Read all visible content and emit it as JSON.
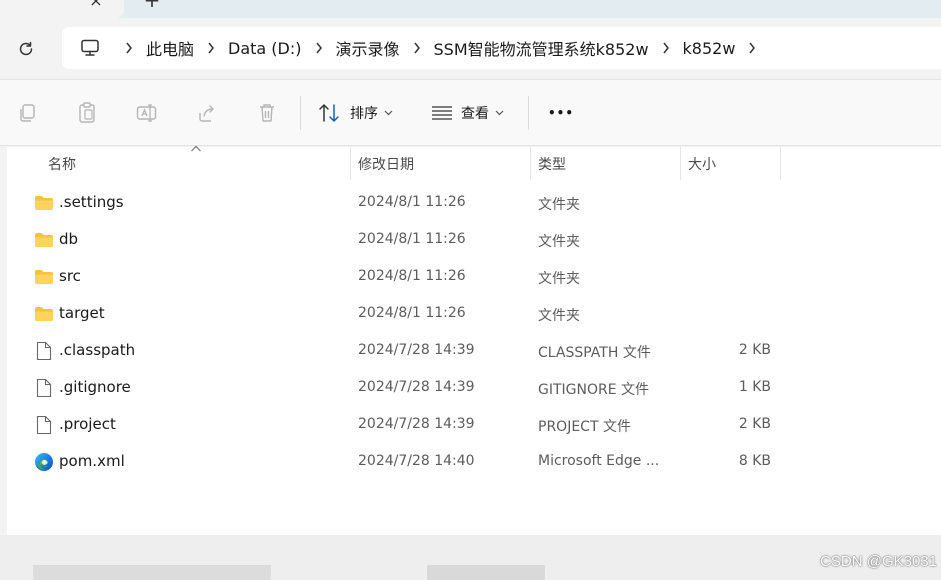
{
  "tabs": {
    "close_glyph": "×",
    "new_glyph": "+"
  },
  "address": {
    "crumbs": [
      "此电脑",
      "Data (D:)",
      "演示录像",
      "SSM智能物流管理系统k852w",
      "k852w"
    ]
  },
  "toolbar": {
    "sort_label": "排序",
    "view_label": "查看",
    "more_label": "•••"
  },
  "columns": {
    "name": "名称",
    "modified": "修改日期",
    "type": "类型",
    "size": "大小"
  },
  "files": [
    {
      "icon": "folder-icon",
      "name": ".settings",
      "modified": "2024/8/1 11:26",
      "type": "文件夹",
      "size": ""
    },
    {
      "icon": "folder-icon",
      "name": "db",
      "modified": "2024/8/1 11:26",
      "type": "文件夹",
      "size": ""
    },
    {
      "icon": "folder-icon",
      "name": "src",
      "modified": "2024/8/1 11:26",
      "type": "文件夹",
      "size": ""
    },
    {
      "icon": "folder-icon",
      "name": "target",
      "modified": "2024/8/1 11:26",
      "type": "文件夹",
      "size": ""
    },
    {
      "icon": "file-icon",
      "name": ".classpath",
      "modified": "2024/7/28 14:39",
      "type": "CLASSPATH 文件",
      "size": "2 KB"
    },
    {
      "icon": "file-icon",
      "name": ".gitignore",
      "modified": "2024/7/28 14:39",
      "type": "GITIGNORE 文件",
      "size": "1 KB"
    },
    {
      "icon": "file-icon",
      "name": ".project",
      "modified": "2024/7/28 14:39",
      "type": "PROJECT 文件",
      "size": "2 KB"
    },
    {
      "icon": "edge-icon",
      "name": "pom.xml",
      "modified": "2024/7/28 14:40",
      "type": "Microsoft Edge ...",
      "size": "8 KB"
    }
  ],
  "watermark": "CSDN @GK3031",
  "colors": {
    "folder": "#f5c242",
    "accent": "#1a73e8"
  }
}
